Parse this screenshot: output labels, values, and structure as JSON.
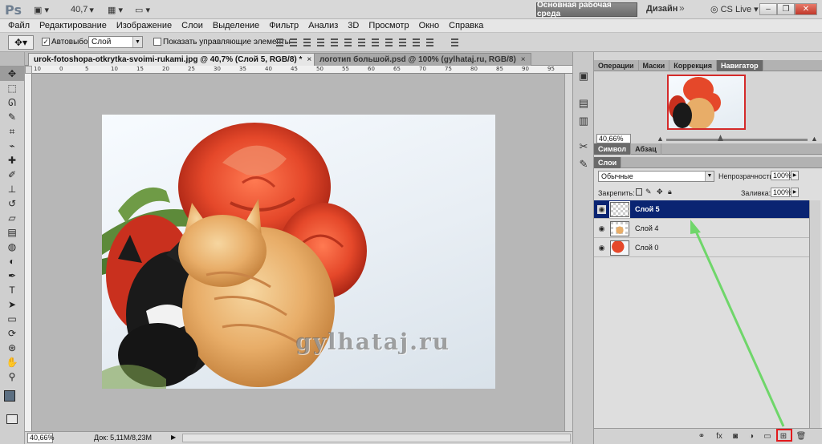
{
  "app": {
    "logo": "Ps",
    "zoom_value": "40,7",
    "workspace": "Основная рабочая среда",
    "design": "Дизайн",
    "more": "»",
    "cslive": "CS Live",
    "cslive_arrow": "▾"
  },
  "menu": [
    "Файл",
    "Редактирование",
    "Изображение",
    "Слои",
    "Выделение",
    "Фильтр",
    "Анализ",
    "3D",
    "Просмотр",
    "Окно",
    "Справка"
  ],
  "options": {
    "autoselect_label": "Автовыбор:",
    "autoselect_value": "Слой",
    "show_controls_label": "Показать управляющие элементы"
  },
  "tabs": {
    "active": "urok-fotoshopa-otkrytka-svoimi-rukami.jpg @ 40,7% (Слой 5, RGB/8) *",
    "inactive": "логотип большой.psd @ 100% (gylhataj.ru, RGB/8)",
    "close": "×"
  },
  "ruler_ticks": [
    "10",
    "0",
    "5",
    "10",
    "15",
    "20",
    "25",
    "30",
    "35",
    "40",
    "45",
    "50",
    "55",
    "60",
    "65",
    "70",
    "75",
    "80",
    "85",
    "90",
    "95"
  ],
  "watermark": "gylhataj.ru",
  "status": {
    "zoom": "40,66%",
    "doc": "Док: 5,11M/8,23M"
  },
  "panels": {
    "top_tabs": [
      "Операции",
      "Маски",
      "Коррекция",
      "Навигатор"
    ],
    "navigator_zoom": "40,66%",
    "char_tabs": [
      "Символ",
      "Абзац"
    ],
    "layers_tab": "Слои",
    "blend_mode": "Обычные",
    "opacity_label": "Непрозрачность:",
    "opacity_value": "100%",
    "lock_label": "Закрепить:",
    "fill_label": "Заливка:",
    "fill_value": "100%",
    "layers": [
      {
        "name": "Слой 5",
        "selected": true
      },
      {
        "name": "Слой 4",
        "selected": false
      },
      {
        "name": "Слой 0",
        "selected": false
      }
    ],
    "bottom_icons": [
      "link-icon",
      "fx-icon",
      "mask-icon",
      "adjustment-icon",
      "group-icon",
      "new-layer-icon",
      "trash-icon"
    ]
  },
  "colors": {
    "selected_layer": "#0a2472",
    "highlight": "#e2191c",
    "arrow": "#6fd66a"
  }
}
